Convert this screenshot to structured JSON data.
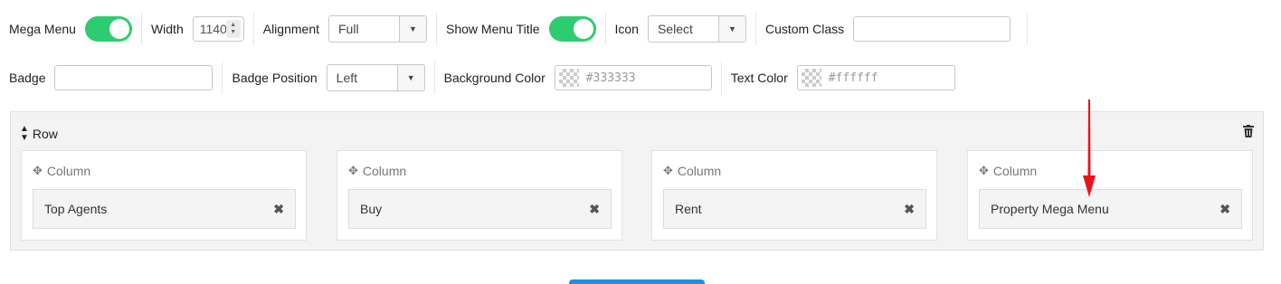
{
  "settings": {
    "mega_menu_label": "Mega Menu",
    "mega_menu_on": true,
    "width_label": "Width",
    "width_value": "1140",
    "alignment_label": "Alignment",
    "alignment_value": "Full",
    "show_menu_title_label": "Show Menu Title",
    "show_menu_title_on": true,
    "icon_label": "Icon",
    "icon_value": "Select",
    "custom_class_label": "Custom Class",
    "custom_class_value": "",
    "badge_label": "Badge",
    "badge_value": "",
    "badge_position_label": "Badge Position",
    "badge_position_value": "Left",
    "background_color_label": "Background Color",
    "background_color_value": "#333333",
    "text_color_label": "Text Color",
    "text_color_value": "#ffffff"
  },
  "layout": {
    "row_label": "Row",
    "columns": [
      {
        "label": "Column",
        "item": "Top Agents"
      },
      {
        "label": "Column",
        "item": "Buy"
      },
      {
        "label": "Column",
        "item": "Rent"
      },
      {
        "label": "Column",
        "item": "Property Mega Menu"
      }
    ]
  },
  "colors": {
    "toggle_on": "#2ecc71",
    "annotation_arrow": "#e8141c",
    "primary_button": "#1e8fe1"
  }
}
